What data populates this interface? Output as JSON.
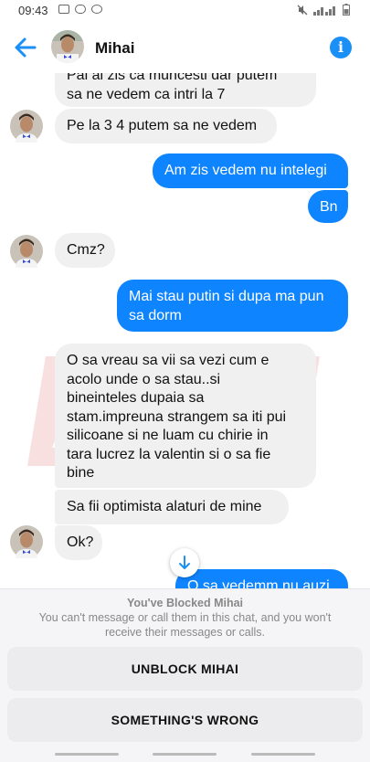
{
  "status_bar": {
    "time": "09:43"
  },
  "header": {
    "contact_name": "Mihai",
    "back_icon": "back-arrow-icon",
    "info_icon": "info-icon"
  },
  "colors": {
    "accent": "#0f84ff",
    "incoming_bubble": "#f1f0f0"
  },
  "messages": [
    {
      "side": "in",
      "text": "Pai ai zis ca muncesti dar putem\nsa ne vedem ca intri la 7"
    },
    {
      "side": "in",
      "text": "Pe la 3 4 putem sa ne vedem"
    },
    {
      "side": "out",
      "text": "Am zis vedem nu intelegi"
    },
    {
      "side": "out",
      "text": "Bn"
    },
    {
      "side": "in",
      "text": "Cmz?"
    },
    {
      "side": "out",
      "text": "Mai stau putin si dupa ma pun\nsa dorm"
    },
    {
      "side": "in",
      "text": "O sa vreau sa vii sa vezi cum e\nacolo unde o sa stau..si\nbineinteles dupaia sa\nstam.impreuna strangem sa iti pui\nsilicoane si ne luam cu chirie in\ntara lucrez la valentin si o sa fie\nbine"
    },
    {
      "side": "in",
      "text": "Sa fii optimista alaturi de mine"
    },
    {
      "side": "in",
      "text": "Ok?"
    },
    {
      "side": "out",
      "text": "O sa vedemm nu auzi"
    }
  ],
  "blocked_panel": {
    "title": "You've Blocked Mihai",
    "description": "You can't message or call them in this chat, and you won't receive their messages or calls.",
    "unblock_label": "UNBLOCK MIHAI",
    "wrong_label": "SOMETHING'S WRONG"
  }
}
